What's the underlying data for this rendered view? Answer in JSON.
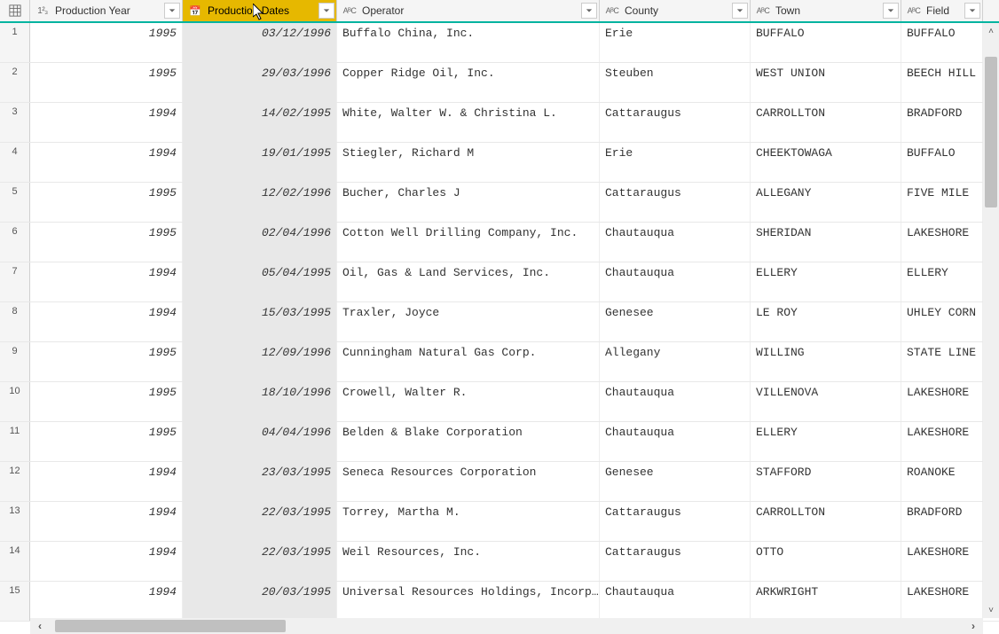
{
  "columns": [
    {
      "key": "year",
      "label": "Production Year",
      "type": "int",
      "width": "col-year",
      "selected": false,
      "cellClass": "num"
    },
    {
      "key": "dates",
      "label": "Production Dates",
      "type": "date",
      "width": "col-dates",
      "selected": true,
      "cellClass": "date selcol"
    },
    {
      "key": "operator",
      "label": "Operator",
      "type": "text",
      "width": "col-operator",
      "selected": false,
      "cellClass": ""
    },
    {
      "key": "county",
      "label": "County",
      "type": "text",
      "width": "col-county",
      "selected": false,
      "cellClass": ""
    },
    {
      "key": "town",
      "label": "Town",
      "type": "text",
      "width": "col-town",
      "selected": false,
      "cellClass": ""
    },
    {
      "key": "field",
      "label": "Field",
      "type": "text",
      "width": "col-field",
      "selected": false,
      "cellClass": ""
    }
  ],
  "rows": [
    {
      "n": "1",
      "year": "1995",
      "dates": "03/12/1996",
      "operator": "Buffalo China, Inc.",
      "county": "Erie",
      "town": "BUFFALO",
      "field": "BUFFALO"
    },
    {
      "n": "2",
      "year": "1995",
      "dates": "29/03/1996",
      "operator": "Copper Ridge Oil, Inc.",
      "county": "Steuben",
      "town": "WEST UNION",
      "field": "BEECH HILL"
    },
    {
      "n": "3",
      "year": "1994",
      "dates": "14/02/1995",
      "operator": "White, Walter W. & Christina L.",
      "county": "Cattaraugus",
      "town": "CARROLLTON",
      "field": "BRADFORD"
    },
    {
      "n": "4",
      "year": "1994",
      "dates": "19/01/1995",
      "operator": "Stiegler, Richard M",
      "county": "Erie",
      "town": "CHEEKTOWAGA",
      "field": "BUFFALO"
    },
    {
      "n": "5",
      "year": "1995",
      "dates": "12/02/1996",
      "operator": "Bucher, Charles J",
      "county": "Cattaraugus",
      "town": "ALLEGANY",
      "field": "FIVE MILE"
    },
    {
      "n": "6",
      "year": "1995",
      "dates": "02/04/1996",
      "operator": "Cotton Well Drilling Company,  Inc.",
      "county": "Chautauqua",
      "town": "SHERIDAN",
      "field": "LAKESHORE"
    },
    {
      "n": "7",
      "year": "1994",
      "dates": "05/04/1995",
      "operator": "Oil, Gas & Land Services, Inc.",
      "county": "Chautauqua",
      "town": "ELLERY",
      "field": "ELLERY"
    },
    {
      "n": "8",
      "year": "1994",
      "dates": "15/03/1995",
      "operator": "Traxler, Joyce",
      "county": "Genesee",
      "town": "LE ROY",
      "field": "UHLEY CORN"
    },
    {
      "n": "9",
      "year": "1995",
      "dates": "12/09/1996",
      "operator": "Cunningham Natural Gas Corp.",
      "county": "Allegany",
      "town": "WILLING",
      "field": "STATE LINE"
    },
    {
      "n": "10",
      "year": "1995",
      "dates": "18/10/1996",
      "operator": "Crowell, Walter R.",
      "county": "Chautauqua",
      "town": "VILLENOVA",
      "field": "LAKESHORE"
    },
    {
      "n": "11",
      "year": "1995",
      "dates": "04/04/1996",
      "operator": "Belden & Blake Corporation",
      "county": "Chautauqua",
      "town": "ELLERY",
      "field": "LAKESHORE"
    },
    {
      "n": "12",
      "year": "1994",
      "dates": "23/03/1995",
      "operator": "Seneca Resources Corporation",
      "county": "Genesee",
      "town": "STAFFORD",
      "field": "ROANOKE"
    },
    {
      "n": "13",
      "year": "1994",
      "dates": "22/03/1995",
      "operator": "Torrey, Martha M.",
      "county": "Cattaraugus",
      "town": "CARROLLTON",
      "field": "BRADFORD"
    },
    {
      "n": "14",
      "year": "1994",
      "dates": "22/03/1995",
      "operator": "Weil Resources, Inc.",
      "county": "Cattaraugus",
      "town": "OTTO",
      "field": "LAKESHORE"
    },
    {
      "n": "15",
      "year": "1994",
      "dates": "20/03/1995",
      "operator": "Universal Resources Holdings, Incorp…",
      "county": "Chautauqua",
      "town": "ARKWRIGHT",
      "field": "LAKESHORE"
    }
  ]
}
